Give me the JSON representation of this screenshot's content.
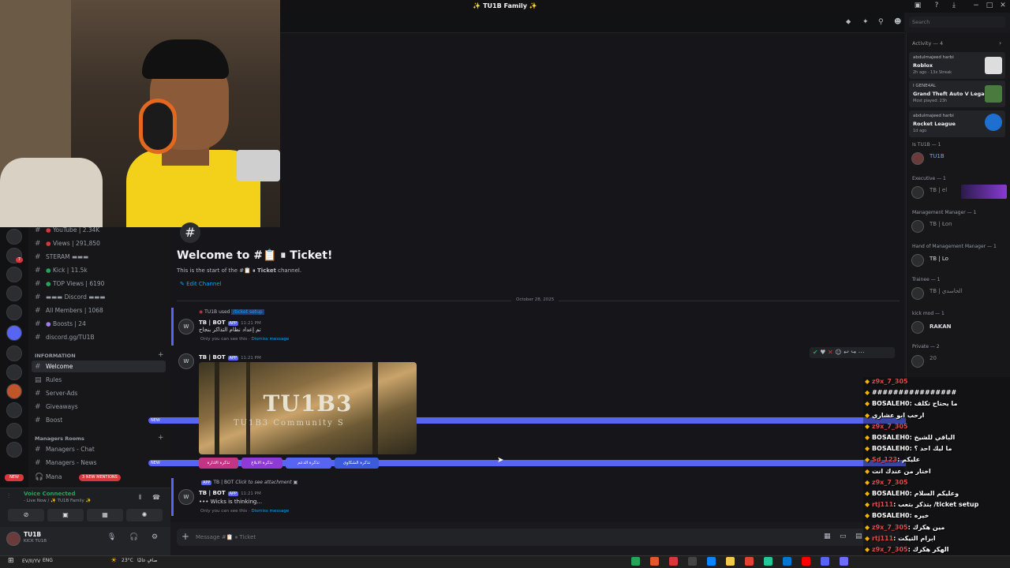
{
  "window": {
    "title": "✨ TU1B Family ✨"
  },
  "search": {
    "placeholder": "Search"
  },
  "channel": {
    "welcome_title": "Welcome to #📋 ⏸ Ticket!",
    "welcome_sub_prefix": "This is the start of the #📋 ",
    "welcome_sub_name": "⏸ Ticket",
    "welcome_sub_suffix": " channel.",
    "edit_label": "Edit Channel",
    "date_divider": "October 28, 2025"
  },
  "sidebar": {
    "top_items": [
      {
        "label": "YouTube | 2.34K"
      },
      {
        "label": "Views | 291,850"
      },
      {
        "label": "STERAM ▬▬▬"
      },
      {
        "label": "Kick | 11.5k"
      },
      {
        "label": "TOP Views | 6190"
      },
      {
        "label": "▬▬▬ Discord ▬▬▬"
      },
      {
        "label": "All Members | 1068"
      },
      {
        "label": "Boosts | 24"
      },
      {
        "label": "discord.gg/TU1B"
      }
    ],
    "cat_information": "INFORMATION",
    "info_items": [
      {
        "label": "Welcome"
      },
      {
        "label": "Rules"
      },
      {
        "label": "Server-Ads"
      },
      {
        "label": "Giveaways"
      },
      {
        "label": "Boost"
      }
    ],
    "new_label": "NEW",
    "cat_managers": "Managers Rooms",
    "manager_items": [
      {
        "label": "Managers - Chat"
      },
      {
        "label": "Managers - News"
      },
      {
        "label": "Mana"
      }
    ],
    "mentions": "3 NEW MENTIONS"
  },
  "voice": {
    "status": "Voice Connected",
    "detail": "- Live Now / ✨ TU1B Family ✨"
  },
  "user": {
    "name": "TU1B",
    "status": "KICK TU1B"
  },
  "messages": {
    "m1_user": "TU1B",
    "m1_used": " used ",
    "m1_cmd": "/ticket setup",
    "bot_name": "TB | BOT",
    "app_tag": "APP",
    "time": "11:21 PM",
    "m1_text": "تم إعداد نظام التذاكر بنجاح",
    "only_you": "Only you can see this · ",
    "dismiss": "Dismiss message",
    "banner_big": "TU1B3",
    "banner_small": "TU1B3 Community S",
    "m3_click": "Click to see attachment",
    "thinking": "Wicks is thinking...",
    "buttons": [
      {
        "label": "تذكرة الادارة",
        "color": "#c13584"
      },
      {
        "label": "تذكرة الابلاغ",
        "color": "#8e3ad4"
      },
      {
        "label": "تذكرة الدعم",
        "color": "#5865f2"
      },
      {
        "label": "تذكرة الشكاوى",
        "color": "#3b5bdb"
      }
    ]
  },
  "composer": {
    "placeholder": "Message #📋 ⏸ Ticket"
  },
  "activity": {
    "title": "Activity — 4",
    "cards": [
      {
        "user": "abdulmajeed harbi",
        "game": "Roblox",
        "detail": "2h ago · 13x Streak"
      },
      {
        "user": "I GENE4AL",
        "game": "Grand Theft Auto V Legacy",
        "detail": "Most played: 23h"
      },
      {
        "user": "abdulmajeed harbi",
        "game": "Rocket League",
        "detail": "1d ago"
      }
    ],
    "roles": [
      {
        "label": "Is TU1B — 1"
      },
      {
        "label": "Executive — 1"
      },
      {
        "label": "Management Manager — 1"
      },
      {
        "label": "Hand of Management Manager — 1"
      },
      {
        "label": "Trainee — 1"
      },
      {
        "label": "kick mod — 1"
      },
      {
        "label": "Private — 2"
      }
    ],
    "members": [
      {
        "label": "TU1B"
      },
      {
        "label": "TB | el"
      },
      {
        "label": "TB | Łon"
      },
      {
        "label": "TB | Lo"
      },
      {
        "label": "TB | الحاسدي"
      },
      {
        "label": "RAKAN"
      },
      {
        "label": "20"
      }
    ]
  },
  "chat": {
    "lines": [
      {
        "user": "z9x_7_305",
        "text": "",
        "red": true
      },
      {
        "user": "",
        "text": "################",
        "red": false
      },
      {
        "user": "BOSALEH0",
        "text": ": ما يحتاج تكلف",
        "red": false
      },
      {
        "user": "",
        "text": "ارحب ابو عشاري",
        "red": false
      },
      {
        "user": "z9x_7_305",
        "text": "",
        "red": true
      },
      {
        "user": "BOSALEH0",
        "text": ": الباقي للشيخ",
        "red": false
      },
      {
        "user": "BOSALEH0",
        "text": ": ما ليك احد ؟",
        "red": false
      },
      {
        "user": "Sd_123",
        "text": ": عليكم",
        "red": true
      },
      {
        "user": "",
        "text": "اختار من عندك انت",
        "red": false
      },
      {
        "user": "z9x_7_305",
        "text": "",
        "red": true
      },
      {
        "user": "BOSALEH0",
        "text": ": وعليكم السلام",
        "red": false
      },
      {
        "user": "rtj111",
        "text": ": بتذكر بتعب /ticket setup",
        "red": true
      },
      {
        "user": "BOSALEH0",
        "text": ": خيره",
        "red": false
      },
      {
        "user": "z9x_7_305",
        "text": ": مين هكرك",
        "red": true
      },
      {
        "user": "rtj111",
        "text": ": ابرام التيكت",
        "red": true
      },
      {
        "user": "z9x_7_305",
        "text": ": الهكر هكرك",
        "red": true
      }
    ]
  },
  "taskbar": {
    "weather": "23°C",
    "weather_text": "صافٍ غالبًا",
    "lang": "ENG",
    "date": "EV/II/YV"
  },
  "colors": {
    "accent": "#5865f2",
    "mention_red": "#da373c",
    "link": "#00a8fc",
    "green": "#23a55a"
  }
}
